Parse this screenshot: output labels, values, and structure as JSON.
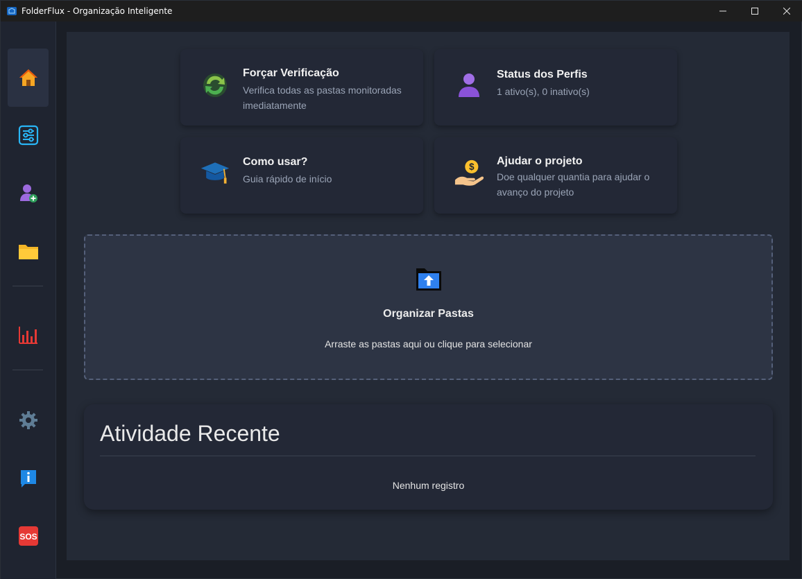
{
  "window": {
    "title": "FolderFlux - Organização Inteligente"
  },
  "sidebar": {
    "items": [
      {
        "name": "home",
        "icon": "home-icon",
        "active": true
      },
      {
        "name": "settings-sliders",
        "icon": "sliders-icon"
      },
      {
        "name": "add-profile",
        "icon": "user-add-icon"
      },
      {
        "name": "folders",
        "icon": "folder-icon"
      },
      {
        "name": "statistics",
        "icon": "bar-chart-icon"
      },
      {
        "name": "settings",
        "icon": "gear-icon"
      },
      {
        "name": "info",
        "icon": "info-icon"
      },
      {
        "name": "help",
        "icon": "sos-icon",
        "label": "SOS"
      }
    ]
  },
  "cards": {
    "force_check": {
      "title": "Forçar Verificação",
      "desc": "Verifica todas as pastas monitoradas imediatamente"
    },
    "profiles": {
      "title": "Status dos Perfis",
      "desc": "1 ativo(s), 0 inativo(s)"
    },
    "howto": {
      "title": "Como usar?",
      "desc": "Guia rápido de início"
    },
    "donate": {
      "title": "Ajudar o projeto",
      "desc": "Doe qualquer quantia para ajudar o avanço do projeto"
    }
  },
  "dropzone": {
    "title": "Organizar Pastas",
    "subtitle": "Arraste as pastas aqui ou clique para selecionar"
  },
  "activity": {
    "title": "Atividade Recente",
    "empty": "Nenhum registro"
  },
  "colors": {
    "accent": "#2f80ed",
    "sidebar_bg": "#1f2430",
    "content_bg": "#242a36",
    "card_bg": "#232836"
  }
}
